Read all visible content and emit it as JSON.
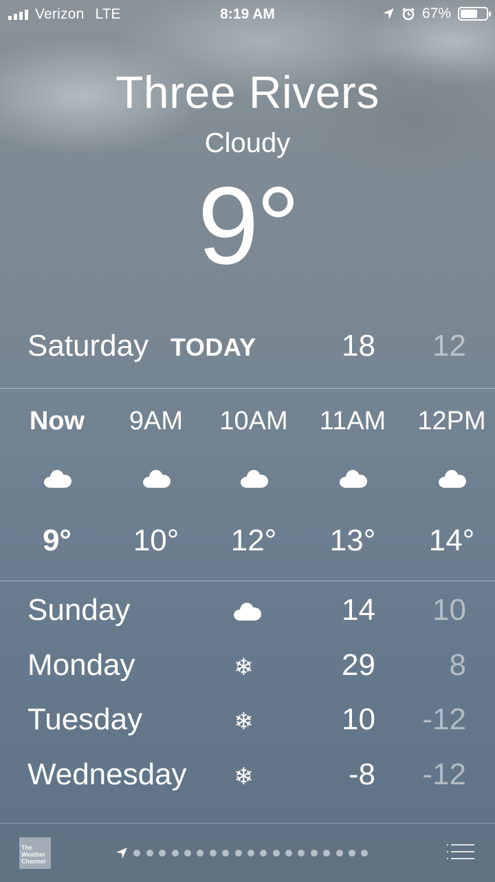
{
  "status_bar": {
    "carrier": "Verizon",
    "network": "LTE",
    "time": "8:19 AM",
    "battery_percent": "67%",
    "battery_level": 0.67
  },
  "location": {
    "city": "Three Rivers",
    "condition": "Cloudy",
    "temperature": "9°"
  },
  "today": {
    "day": "Saturday",
    "label": "TODAY",
    "high": "18",
    "low": "12"
  },
  "hourly": [
    {
      "time": "Now",
      "icon": "cloud-icon",
      "temp": "9°",
      "bold": true
    },
    {
      "time": "9AM",
      "icon": "cloud-icon",
      "temp": "10°"
    },
    {
      "time": "10AM",
      "icon": "cloud-icon",
      "temp": "12°"
    },
    {
      "time": "11AM",
      "icon": "cloud-icon",
      "temp": "13°"
    },
    {
      "time": "12PM",
      "icon": "cloud-icon",
      "temp": "14°"
    }
  ],
  "daily": [
    {
      "day": "Sunday",
      "icon": "cloud-icon",
      "high": "14",
      "low": "10"
    },
    {
      "day": "Monday",
      "icon": "snowflake-icon",
      "high": "29",
      "low": "8"
    },
    {
      "day": "Tuesday",
      "icon": "snowflake-icon",
      "high": "10",
      "low": "-12"
    },
    {
      "day": "Wednesday",
      "icon": "snowflake-icon",
      "high": "-8",
      "low": "-12"
    }
  ],
  "bottom_bar": {
    "provider_logo": "The Weather Channel",
    "page_dots": 19
  }
}
